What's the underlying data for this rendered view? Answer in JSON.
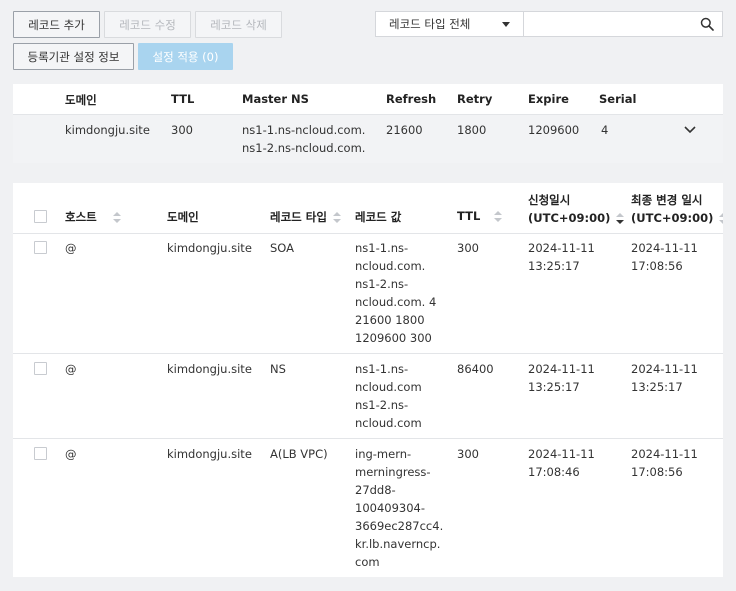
{
  "toolbar": {
    "add_record": "레코드 추가",
    "edit_record": "레코드 수정",
    "delete_record": "레코드 삭제",
    "registrar_info": "등록기관 설정 정보",
    "apply_settings": "설정 적용 (0)"
  },
  "filter": {
    "record_type_selected": "레코드 타입 전체",
    "search_placeholder": ""
  },
  "zone_table": {
    "headers": [
      "도메인",
      "TTL",
      "Master NS",
      "Refresh",
      "Retry",
      "Expire",
      "Serial"
    ],
    "row": {
      "domain": "kimdongju.site",
      "ttl": "300",
      "master_ns_1": "ns1-1.ns-ncloud.com.",
      "master_ns_2": "ns1-2.ns-ncloud.com.",
      "refresh": "21600",
      "retry": "1800",
      "expire": "1209600",
      "serial": "4"
    }
  },
  "record_table": {
    "headers": {
      "host": "호스트",
      "domain": "도메인",
      "record_type": "레코드 타입",
      "record_value": "레코드 값",
      "ttl": "TTL",
      "requested_1": "신청일시",
      "requested_2": "(UTC+09:00)",
      "modified_1": "최종 변경 일시",
      "modified_2": "(UTC+09:00)"
    },
    "rows": [
      {
        "host": "@",
        "domain": "kimdongju.site",
        "type": "SOA",
        "value_lines": [
          "ns1-1.ns-",
          "ncloud.com.",
          "ns1-2.ns-",
          "ncloud.com. 4",
          "21600 1800",
          "1209600 300"
        ],
        "ttl": "300",
        "requested_date": "2024-11-11",
        "requested_time": "13:25:17",
        "modified_date": "2024-11-11",
        "modified_time": "17:08:56"
      },
      {
        "host": "@",
        "domain": "kimdongju.site",
        "type": "NS",
        "value_lines": [
          "ns1-1.ns-",
          "ncloud.com",
          "ns1-2.ns-",
          "ncloud.com"
        ],
        "ttl": "86400",
        "requested_date": "2024-11-11",
        "requested_time": "13:25:17",
        "modified_date": "2024-11-11",
        "modified_time": "13:25:17"
      },
      {
        "host": "@",
        "domain": "kimdongju.site",
        "type": "A(LB VPC)",
        "value_lines": [
          "ing-mern-",
          "merningress-",
          "27dd8-",
          "100409304-",
          "3669ec287cc4.",
          "kr.lb.naverncp.",
          "com"
        ],
        "ttl": "300",
        "requested_date": "2024-11-11",
        "requested_time": "17:08:46",
        "modified_date": "2024-11-11",
        "modified_time": "17:08:56"
      }
    ]
  },
  "icons": {
    "search": "search-icon",
    "caret": "caret-down-icon",
    "expand": "chevron-down-icon"
  }
}
